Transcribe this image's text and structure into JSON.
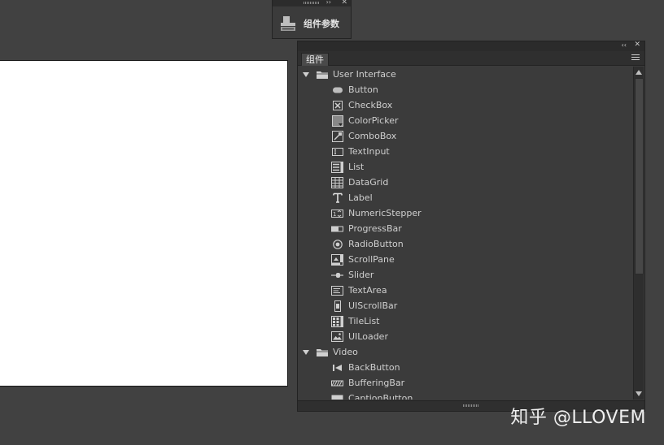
{
  "mini_panel": {
    "label": "组件参数",
    "icon": "component-parameters-icon"
  },
  "panel": {
    "tab_label": "组件",
    "folders": [
      {
        "label": "User Interface",
        "expanded": true,
        "items": [
          {
            "label": "Button",
            "icon": "button-icon"
          },
          {
            "label": "CheckBox",
            "icon": "checkbox-icon"
          },
          {
            "label": "ColorPicker",
            "icon": "colorpicker-icon"
          },
          {
            "label": "ComboBox",
            "icon": "combobox-icon"
          },
          {
            "label": "TextInput",
            "icon": "textinput-icon"
          },
          {
            "label": "List",
            "icon": "list-icon"
          },
          {
            "label": "DataGrid",
            "icon": "datagrid-icon"
          },
          {
            "label": "Label",
            "icon": "label-icon"
          },
          {
            "label": "NumericStepper",
            "icon": "numericstepper-icon"
          },
          {
            "label": "ProgressBar",
            "icon": "progressbar-icon"
          },
          {
            "label": "RadioButton",
            "icon": "radiobutton-icon"
          },
          {
            "label": "ScrollPane",
            "icon": "scrollpane-icon"
          },
          {
            "label": "Slider",
            "icon": "slider-icon"
          },
          {
            "label": "TextArea",
            "icon": "textarea-icon"
          },
          {
            "label": "UIScrollBar",
            "icon": "uiscrollbar-icon"
          },
          {
            "label": "TileList",
            "icon": "tilelist-icon"
          },
          {
            "label": "UILoader",
            "icon": "uiloader-icon"
          }
        ]
      },
      {
        "label": "Video",
        "expanded": true,
        "items": [
          {
            "label": "BackButton",
            "icon": "backbutton-icon"
          },
          {
            "label": "BufferingBar",
            "icon": "bufferingbar-icon"
          },
          {
            "label": "CaptionButton",
            "icon": "captionbutton-icon"
          }
        ]
      }
    ]
  },
  "watermark": "知乎 @LLOVEM"
}
